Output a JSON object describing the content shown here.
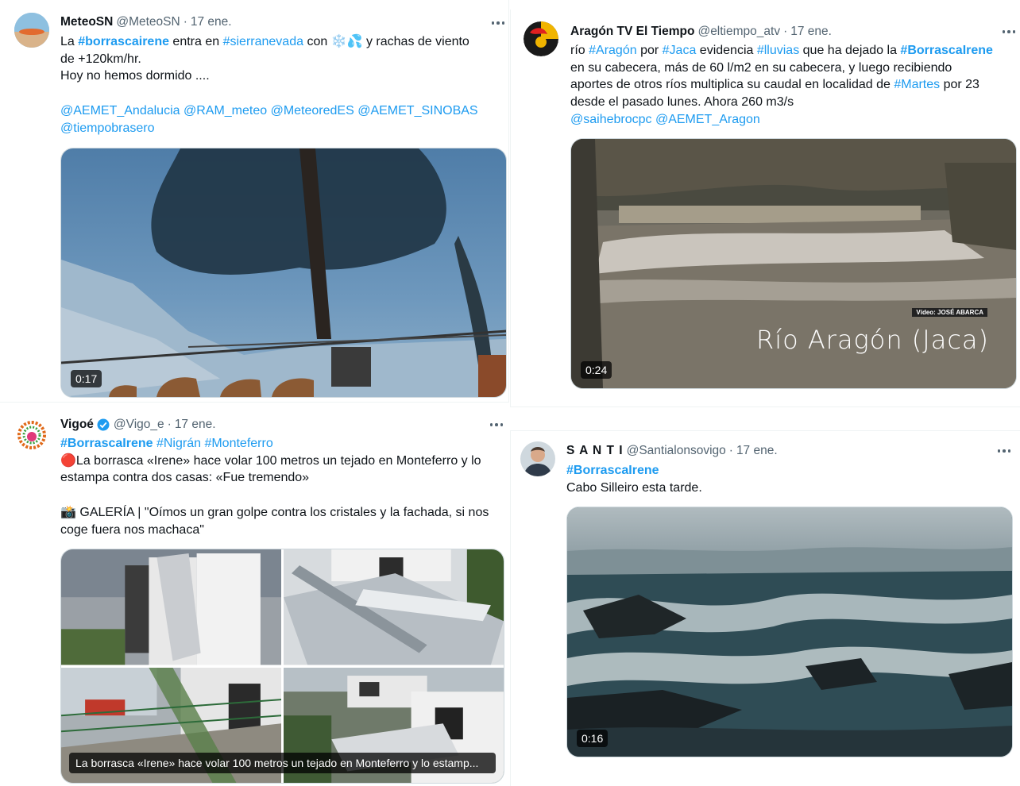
{
  "tweets": [
    {
      "name": "MeteoSN",
      "handle": "@MeteoSN",
      "dot": "·",
      "date": "17 ene.",
      "lines": [
        [
          {
            "t": "La "
          },
          {
            "t": "#borrascairene",
            "c": "tag"
          },
          {
            "t": " entra en "
          },
          {
            "t": "#sierranevada",
            "c": "lnk"
          },
          {
            "t": " con ❄️💦 y rachas de viento"
          }
        ],
        [
          {
            "t": "de +120km/hr."
          }
        ],
        [
          {
            "t": "Hoy no hemos dormido ...."
          }
        ],
        [
          {
            "t": ""
          }
        ],
        [
          {
            "t": "@AEMET_Andalucia @RAM_meteo @MeteoredES @AEMET_SINOBAS",
            "c": "lnk"
          }
        ],
        [
          {
            "t": "@tiempobrasero",
            "c": "lnk"
          }
        ]
      ],
      "video_duration": "0:17"
    },
    {
      "name": "Aragón TV El Tiempo",
      "handle": "@eltiempo_atv",
      "dot": "·",
      "date": "17 ene.",
      "lines": [
        [
          {
            "t": "río "
          },
          {
            "t": "#Aragón",
            "c": "lnk"
          },
          {
            "t": " por "
          },
          {
            "t": "#Jaca",
            "c": "lnk"
          },
          {
            "t": " evidencia "
          },
          {
            "t": "#lluvias",
            "c": "lnk"
          },
          {
            "t": " que ha dejado la "
          },
          {
            "t": "#BorrascaIrene",
            "c": "tag"
          }
        ],
        [
          {
            "t": "en su cabecera, más de 60 l/m2 en su cabecera, y luego recibiendo"
          }
        ],
        [
          {
            "t": "aportes de otros ríos multiplica su caudal en localidad de "
          },
          {
            "t": "#Martes",
            "c": "lnk"
          },
          {
            "t": " por 23"
          }
        ],
        [
          {
            "t": "desde el pasado lunes. Ahora 260 m3/s"
          }
        ],
        [
          {
            "t": "@saihebrocpc @AEMET_Aragon",
            "c": "lnk"
          }
        ]
      ],
      "video_duration": "0:24",
      "video_title": "Río Aragón (Jaca)",
      "video_credit": "Vídeo: JOSÉ ABARCA"
    },
    {
      "name": "Vigoé",
      "handle": "@Vigo_e",
      "dot": "·",
      "date": "17 ene.",
      "lines": [
        [
          {
            "t": "#BorrascaIrene",
            "c": "tag"
          },
          {
            "t": " "
          },
          {
            "t": "#Nigrán",
            "c": "lnk"
          },
          {
            "t": " "
          },
          {
            "t": "#Monteferro",
            "c": "lnk"
          }
        ],
        [
          {
            "t": "🔴La borrasca «Irene» hace volar 100 metros un tejado en Monteferro y lo"
          }
        ],
        [
          {
            "t": "estampa contra dos casas: «Fue tremendo»"
          }
        ],
        [
          {
            "t": ""
          }
        ],
        [
          {
            "t": "📸 GALERÍA | \"Oímos un gran golpe contra los cristales y la fachada, si nos"
          }
        ],
        [
          {
            "t": "coge fuera nos machaca\""
          }
        ]
      ],
      "gallery_caption": "La borrasca «Irene» hace volar 100 metros un tejado en Monteferro y lo estamp..."
    },
    {
      "name": "S A N T I",
      "handle": "@Santialonsovigo",
      "dot": "·",
      "date": "17 ene.",
      "lines": [
        [
          {
            "t": "#BorrascaIrene",
            "c": "tag"
          }
        ],
        [
          {
            "t": "Cabo Silleiro esta tarde."
          }
        ]
      ],
      "video_duration": "0:16"
    }
  ],
  "colors": {
    "link": "#1d9bf0",
    "text": "#0f1419",
    "muted": "#536471"
  }
}
